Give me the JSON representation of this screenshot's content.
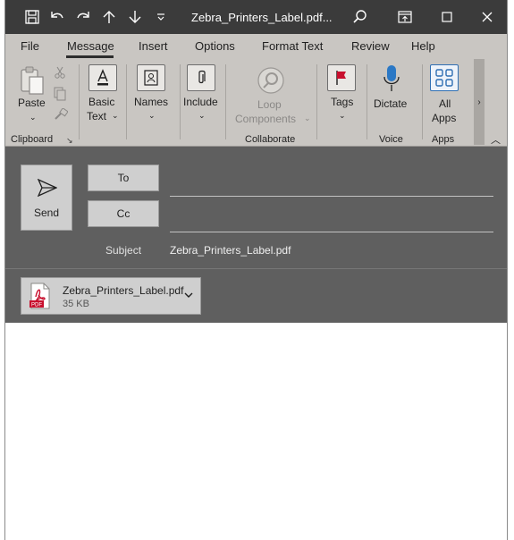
{
  "window": {
    "title": "Zebra_Printers_Label.pdf..."
  },
  "titlebar_icons": [
    "save-icon",
    "undo-icon",
    "redo-icon",
    "arrow-up-icon",
    "arrow-down-icon",
    "customize-chevron-icon",
    "search-icon",
    "restore-icon",
    "maximize-icon",
    "close-icon"
  ],
  "menu": {
    "items": [
      "File",
      "Message",
      "Insert",
      "Options",
      "Format Text",
      "Review",
      "Help"
    ],
    "active": "Message"
  },
  "ribbon": {
    "paste": "Paste",
    "basic_text_1": "Basic",
    "basic_text_2": "Text",
    "names": "Names",
    "include": "Include",
    "loop_1": "Loop",
    "loop_2": "Components",
    "tags": "Tags",
    "dictate": "Dictate",
    "all_apps_1": "All",
    "all_apps_2": "Apps",
    "groups": {
      "clipboard": "Clipboard",
      "collaborate": "Collaborate",
      "voice": "Voice",
      "apps": "Apps"
    }
  },
  "compose": {
    "send": "Send",
    "to": "To",
    "cc": "Cc",
    "subject_label": "Subject",
    "subject_value": "Zebra_Printers_Label.pdf"
  },
  "attachment": {
    "name": "Zebra_Printers_Label.pdf",
    "size": "35 KB",
    "badge": "PDF"
  },
  "colors": {
    "titlebar": "#3b3b3b",
    "ribbon": "#c9c6c2",
    "compose": "#5f5f5f",
    "pdf_red": "#c8102e",
    "dictate_blue": "#2b78c5",
    "apps_blue": "#2f6fb3",
    "tags_red": "#c8102e"
  }
}
